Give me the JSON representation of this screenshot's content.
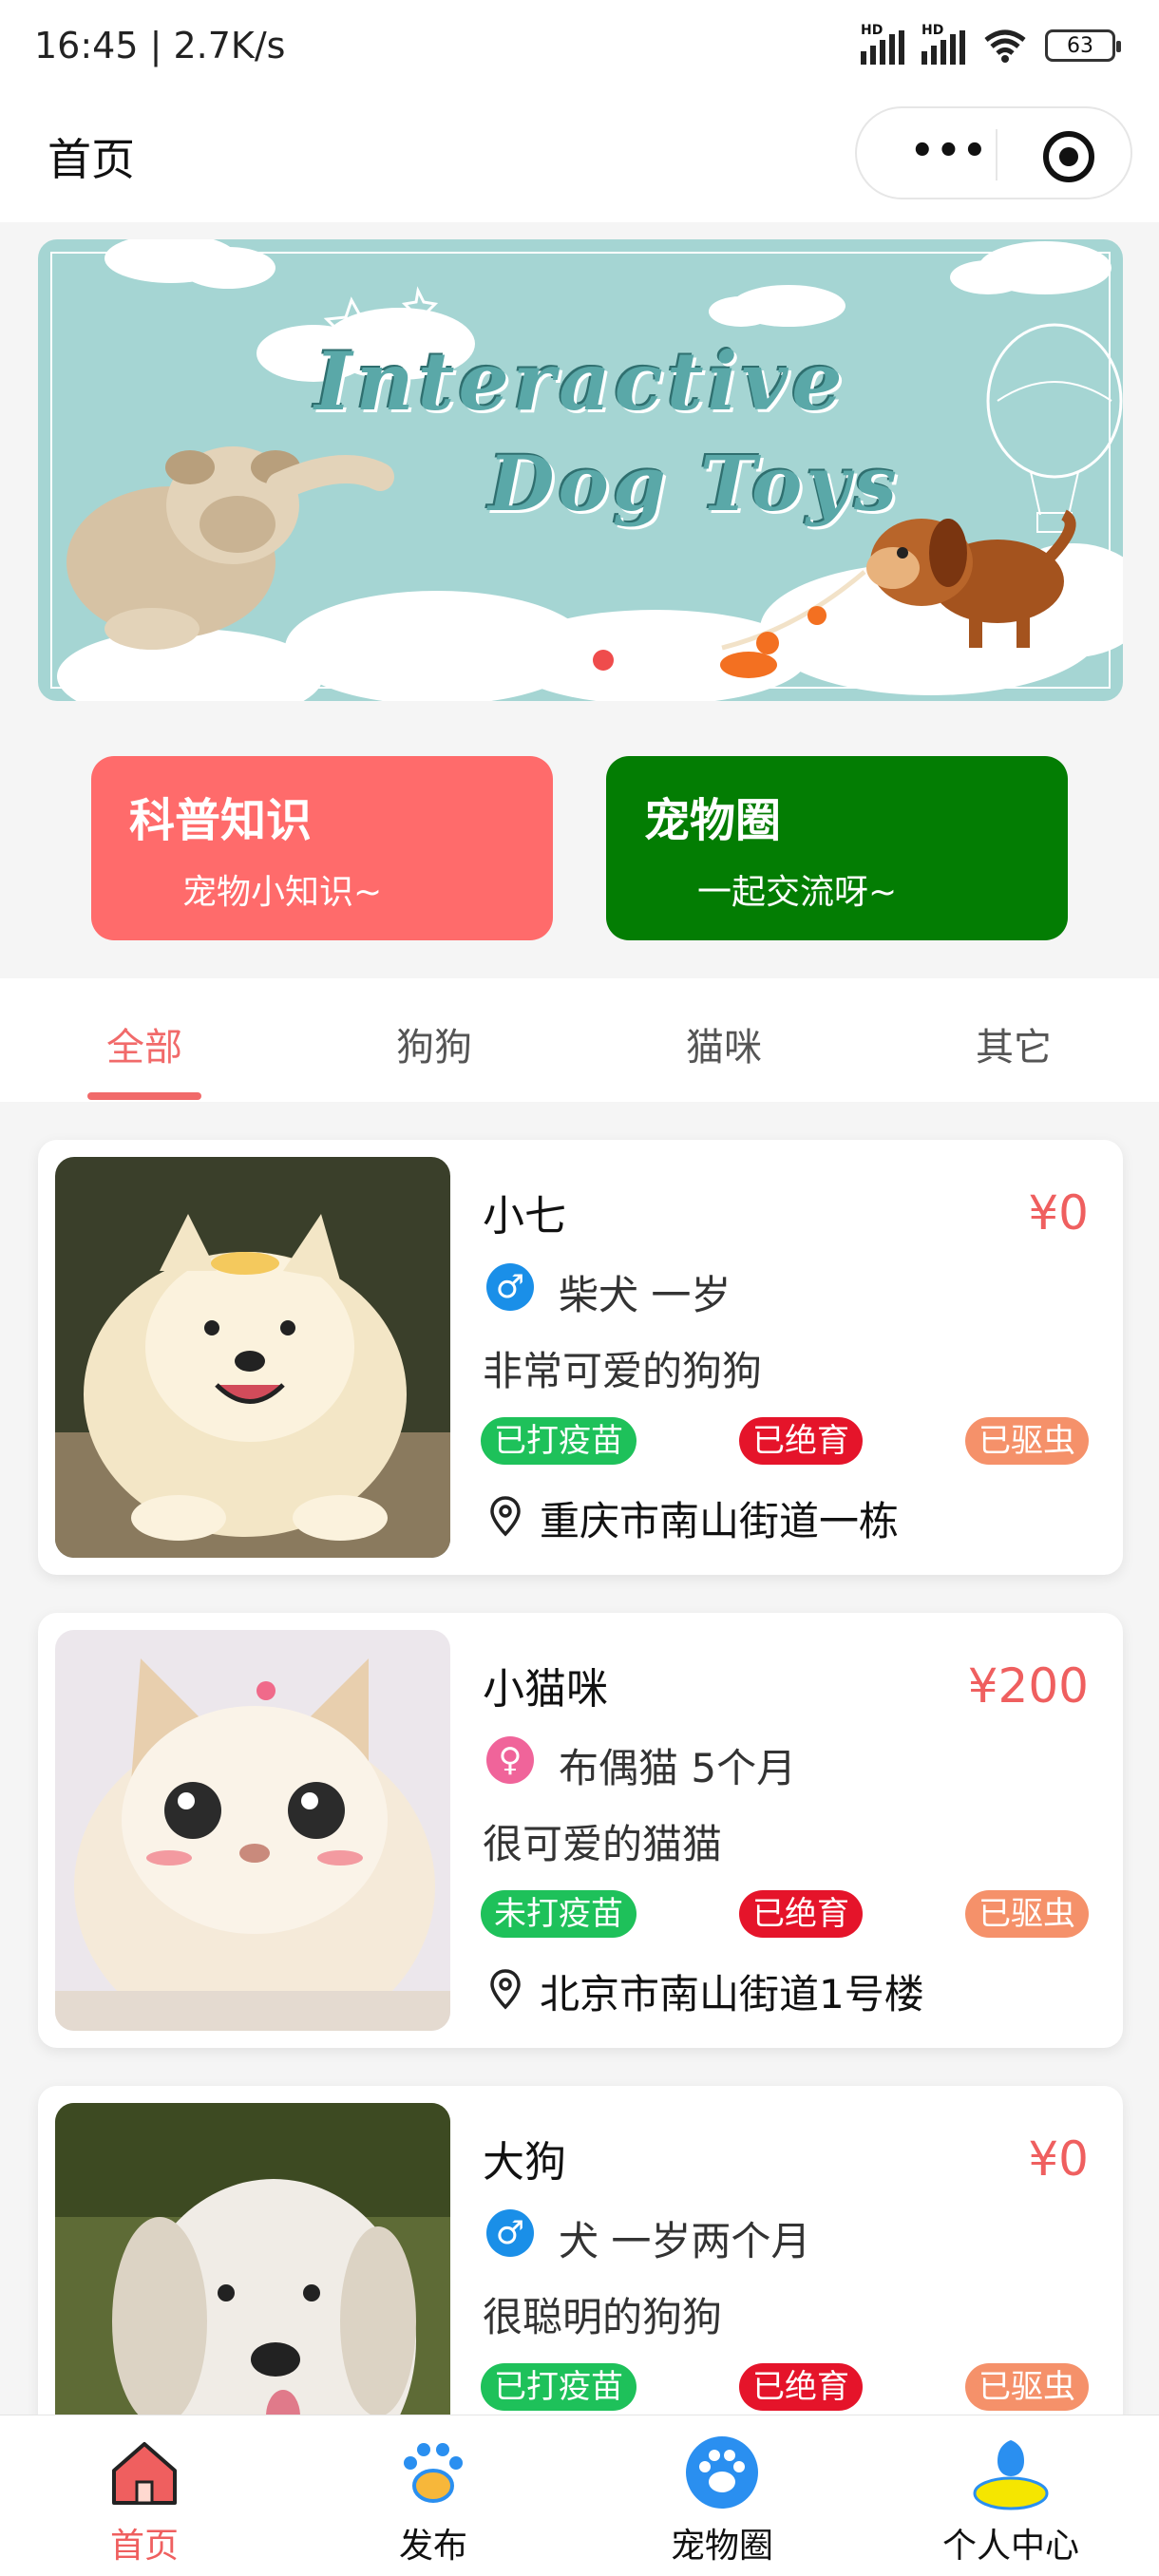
{
  "status_bar": {
    "time": "16:45 | 2.7K/s",
    "hd_1": "HD",
    "hd_2": "HD",
    "battery": "63"
  },
  "nav": {
    "title": "首页"
  },
  "banner": {
    "line1": "Interactive",
    "line2": "Dog Toys"
  },
  "quick_links": [
    {
      "title": "科普知识",
      "subtitle": "宠物小知识~",
      "color": "#ff6b6b"
    },
    {
      "title": "宠物圈",
      "subtitle": "一起交流呀~",
      "color": "#037d03"
    }
  ],
  "tabs": [
    {
      "label": "全部",
      "active": true
    },
    {
      "label": "狗狗"
    },
    {
      "label": "猫咪"
    },
    {
      "label": "其它"
    }
  ],
  "pets": [
    {
      "name": "小七",
      "price": "¥0",
      "gender": "male",
      "breed": "柴犬 一岁",
      "desc": "非常可爱的狗狗",
      "tags": [
        "已打疫苗",
        "已绝育",
        "已驱虫"
      ],
      "address": "重庆市南山街道一栋",
      "gender_icon": "male-icon"
    },
    {
      "name": "小猫咪",
      "price": "¥200",
      "gender": "female",
      "breed": "布偶猫 5个月",
      "desc": "很可爱的猫猫",
      "tags": [
        "未打疫苗",
        "已绝育",
        "已驱虫"
      ],
      "address": "北京市南山街道1号楼",
      "gender_icon": "female-icon"
    },
    {
      "name": "大狗",
      "price": "¥0",
      "gender": "male",
      "breed": "犬 一岁两个月",
      "desc": "很聪明的狗狗",
      "tags": [
        "已打疫苗",
        "已绝育",
        "已驱虫"
      ],
      "address": "",
      "gender_icon": "male-icon"
    }
  ],
  "tabbar": [
    {
      "label": "首页",
      "icon": "home-icon",
      "active": true
    },
    {
      "label": "发布",
      "icon": "paw-print-icon"
    },
    {
      "label": "宠物圈",
      "icon": "paw-circle-icon"
    },
    {
      "label": "个人中心",
      "icon": "profile-icon"
    }
  ],
  "colors": {
    "accent": "#ef5f5f",
    "green": "#037d03",
    "tag_vaccine": "#1ec15a",
    "tag_neutered": "#e5142a",
    "tag_dewormed": "#f5916a"
  }
}
